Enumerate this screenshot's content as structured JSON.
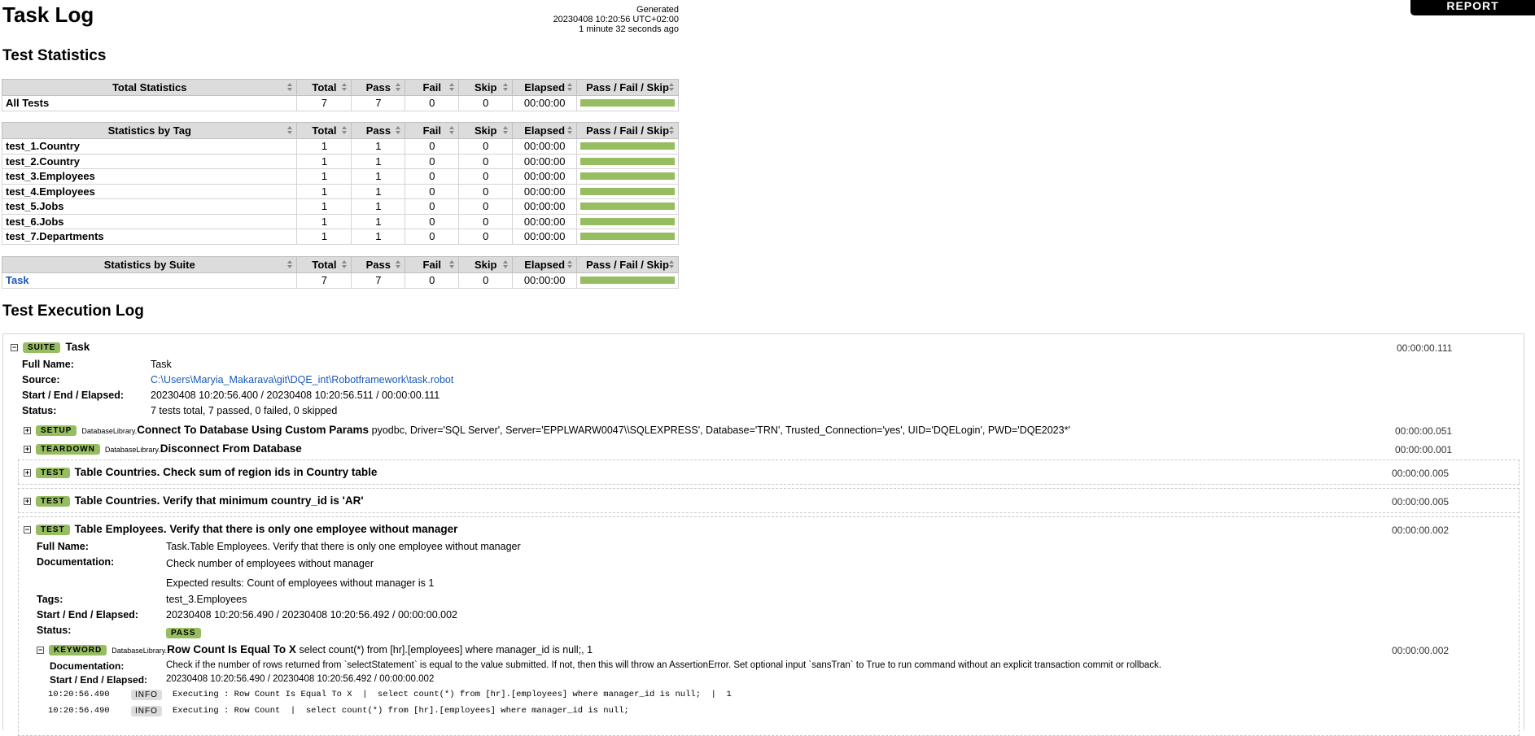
{
  "header": {
    "title": "Task Log",
    "generated_label": "Generated",
    "generated_time": "20230408 10:20:56 UTC+02:00",
    "generated_ago": "1 minute 32 seconds ago",
    "report_button": "REPORT"
  },
  "stats_title": "Test Statistics",
  "total_stats": {
    "header": [
      "Total Statistics",
      "Total",
      "Pass",
      "Fail",
      "Skip",
      "Elapsed",
      "Pass / Fail / Skip"
    ],
    "rows": [
      {
        "name": "All Tests",
        "total": "7",
        "pass": "7",
        "fail": "0",
        "skip": "0",
        "elapsed": "00:00:00",
        "pass_fraction": 1.0
      }
    ]
  },
  "tag_stats": {
    "header": [
      "Statistics by Tag",
      "Total",
      "Pass",
      "Fail",
      "Skip",
      "Elapsed",
      "Pass / Fail / Skip"
    ],
    "rows": [
      {
        "name": "test_1.Country",
        "total": "1",
        "pass": "1",
        "fail": "0",
        "skip": "0",
        "elapsed": "00:00:00",
        "pass_fraction": 1.0
      },
      {
        "name": "test_2.Country",
        "total": "1",
        "pass": "1",
        "fail": "0",
        "skip": "0",
        "elapsed": "00:00:00",
        "pass_fraction": 1.0
      },
      {
        "name": "test_3.Employees",
        "total": "1",
        "pass": "1",
        "fail": "0",
        "skip": "0",
        "elapsed": "00:00:00",
        "pass_fraction": 1.0
      },
      {
        "name": "test_4.Employees",
        "total": "1",
        "pass": "1",
        "fail": "0",
        "skip": "0",
        "elapsed": "00:00:00",
        "pass_fraction": 1.0
      },
      {
        "name": "test_5.Jobs",
        "total": "1",
        "pass": "1",
        "fail": "0",
        "skip": "0",
        "elapsed": "00:00:00",
        "pass_fraction": 1.0
      },
      {
        "name": "test_6.Jobs",
        "total": "1",
        "pass": "1",
        "fail": "0",
        "skip": "0",
        "elapsed": "00:00:00",
        "pass_fraction": 1.0
      },
      {
        "name": "test_7.Departments",
        "total": "1",
        "pass": "1",
        "fail": "0",
        "skip": "0",
        "elapsed": "00:00:00",
        "pass_fraction": 1.0
      }
    ]
  },
  "suite_stats": {
    "header": [
      "Statistics by Suite",
      "Total",
      "Pass",
      "Fail",
      "Skip",
      "Elapsed",
      "Pass / Fail / Skip"
    ],
    "rows": [
      {
        "name": "Task",
        "total": "7",
        "pass": "7",
        "fail": "0",
        "skip": "0",
        "elapsed": "00:00:00",
        "pass_fraction": 1.0
      }
    ]
  },
  "log_title": "Test Execution Log",
  "suite": {
    "badge": "SUITE",
    "name": "Task",
    "elapsed": "00:00:00.111",
    "full_name_label": "Full Name:",
    "full_name": "Task",
    "source_label": "Source:",
    "source": "C:\\Users\\Maryia_Makarava\\git\\DQE_int\\Robotframework\\task.robot",
    "times_label": "Start / End / Elapsed:",
    "times": "20230408 10:20:56.400 / 20230408 10:20:56.511 / 00:00:00.111",
    "status_label": "Status:",
    "status": "7 tests total, 7 passed, 0 failed, 0 skipped"
  },
  "setup": {
    "badge": "SETUP",
    "library": "DatabaseLibrary.",
    "keyword": "Connect To Database Using Custom Params",
    "args": "pyodbc, Driver='SQL Server', Server='EPPLWARW0047\\\\SQLEXPRESS', Database='TRN', Trusted_Connection='yes', UID='DQELogin', PWD='DQE2023*'",
    "elapsed": "00:00:00.051"
  },
  "teardown": {
    "badge": "TEARDOWN",
    "library": "DatabaseLibrary.",
    "keyword": "Disconnect From Database",
    "elapsed": "00:00:00.001"
  },
  "tests": [
    {
      "badge": "TEST",
      "name": "Table Countries. Check sum of region ids in Country table",
      "elapsed": "00:00:00.005"
    },
    {
      "badge": "TEST",
      "name": "Table Countries. Verify that minimum country_id is 'AR'",
      "elapsed": "00:00:00.005"
    },
    {
      "badge": "TEST",
      "name": "Table Employees. Verify that there is only one employee without manager",
      "elapsed": "00:00:00.002"
    }
  ],
  "open_test": {
    "full_name_label": "Full Name:",
    "full_name": "Task.Table Employees. Verify that there is only one employee without manager",
    "doc_label": "Documentation:",
    "doc_line1": "Check number of employees without manager",
    "doc_line2": "Expected results: Count of employees without manager is 1",
    "tags_label": "Tags:",
    "tags": "test_3.Employees",
    "times_label": "Start / End / Elapsed:",
    "times": "20230408 10:20:56.490 / 20230408 10:20:56.492 / 00:00:00.002",
    "status_label": "Status:",
    "status": "PASS"
  },
  "keyword": {
    "badge": "KEYWORD",
    "library": "DatabaseLibrary.",
    "name": "Row Count Is Equal To X",
    "args": "select count(*) from [hr].[employees] where manager_id is null;, 1",
    "elapsed": "00:00:00.002",
    "doc_label": "Documentation:",
    "doc": "Check if the number of rows returned from `selectStatement` is equal to the value submitted. If not, then this will throw an AssertionError. Set optional input `sansTran` to True to run command without an explicit transaction commit or rollback.",
    "times_label": "Start / End / Elapsed:",
    "times": "20230408 10:20:56.490 / 20230408 10:20:56.492 / 00:00:00.002",
    "messages": [
      {
        "time": "10:20:56.490",
        "level": "INFO",
        "text": "Executing : Row Count Is Equal To X  |  select count(*) from [hr].[employees] where manager_id is null;  |  1"
      },
      {
        "time": "10:20:56.490",
        "level": "INFO",
        "text": "Executing : Row Count  |  select count(*) from [hr].[employees] where manager_id is null;"
      }
    ]
  },
  "colors": {
    "pass": "#97bd61",
    "header_bg": "#dcdcdc",
    "link": "#1a58b7"
  }
}
